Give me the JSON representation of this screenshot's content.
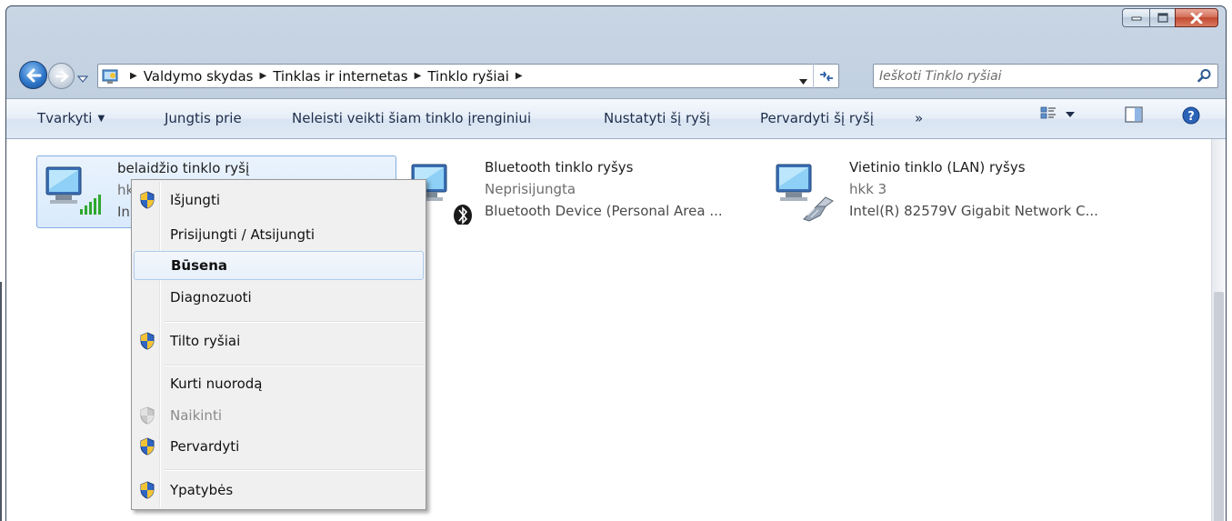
{
  "address_bar": {
    "crumbs": [
      "Valdymo skydas",
      "Tinklas ir internetas",
      "Tinklo ryšiai"
    ]
  },
  "search": {
    "placeholder": "Ieškoti Tinklo ryšiai"
  },
  "command_bar": {
    "organize": "Tvarkyti",
    "connect": "Jungtis prie",
    "disable": "Neleisti veikti šiam tinklo įrenginiui",
    "diagnose": "Nustatyti šį ryšį",
    "rename": "Pervardyti šį ryšį",
    "more": "»"
  },
  "items": [
    {
      "title": "belaidžio tinklo ryšį",
      "sub": "hk",
      "device": "In"
    },
    {
      "title": "Bluetooth tinklo ryšys",
      "sub": "Neprisijungta",
      "device": "Bluetooth Device (Personal Area ..."
    },
    {
      "title": "Vietinio tinklo (LAN) ryšys",
      "sub": "hkk  3",
      "device": "Intel(R) 82579V Gigabit Network C..."
    }
  ],
  "context_menu": {
    "items": [
      {
        "label": "Išjungti"
      },
      {
        "label": "Prisijungti / Atsijungti"
      },
      {
        "label": "Būsena"
      },
      {
        "label": "Diagnozuoti"
      },
      {
        "label": "Tilto ryšiai"
      },
      {
        "label": "Kurti nuorodą"
      },
      {
        "label": "Naikinti"
      },
      {
        "label": "Pervardyti"
      },
      {
        "label": "Ypatybės"
      }
    ]
  },
  "colors": {
    "accent": "#2e76c9",
    "selection": "#d9eafc",
    "menu_bg": "#f0f0f0"
  }
}
